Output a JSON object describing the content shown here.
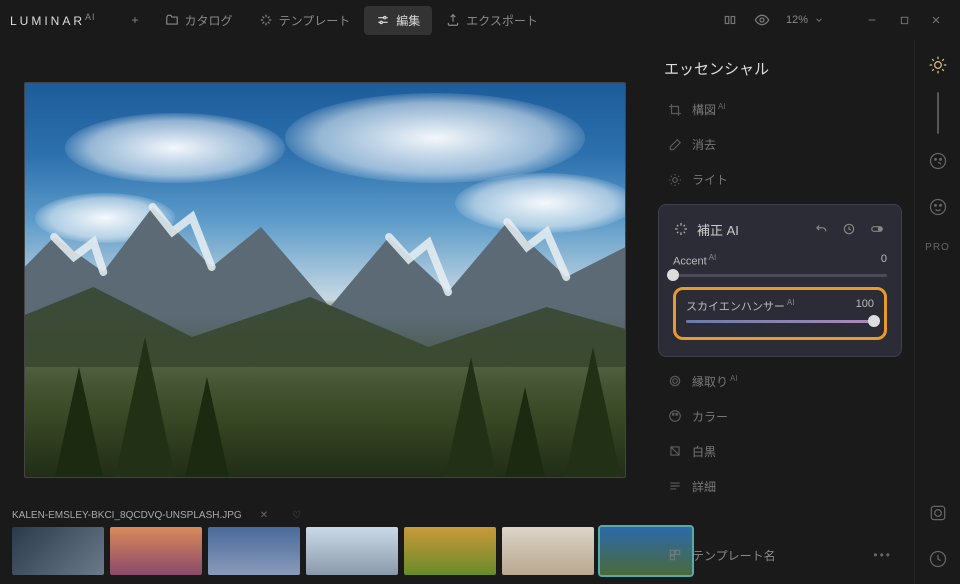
{
  "app_name": "LUMINAR",
  "app_suffix": "AI",
  "topnav": {
    "add": "+",
    "catalog": "カタログ",
    "templates": "テンプレート",
    "edit": "編集",
    "export": "エクスポート"
  },
  "zoom": {
    "value": "12%"
  },
  "section_title": "エッセンシャル",
  "tools": {
    "composition": "構図",
    "erase": "消去",
    "light": "ライト",
    "enhance": "補正",
    "edge": "縁取り",
    "color": "カラー",
    "bw": "白黒",
    "details": "詳細"
  },
  "ai_sup": "AI",
  "sliders": {
    "accent": {
      "label": "Accent",
      "value": 0
    },
    "sky": {
      "label": "スカイエンハンサー",
      "value": 100
    }
  },
  "rail": {
    "pro": "PRO"
  },
  "filmstrip": {
    "filename": "KALEN-EMSLEY-BKCI_8QCDVQ-UNSPLASH.JPG"
  },
  "template_footer": {
    "label": "テンプレート名"
  }
}
